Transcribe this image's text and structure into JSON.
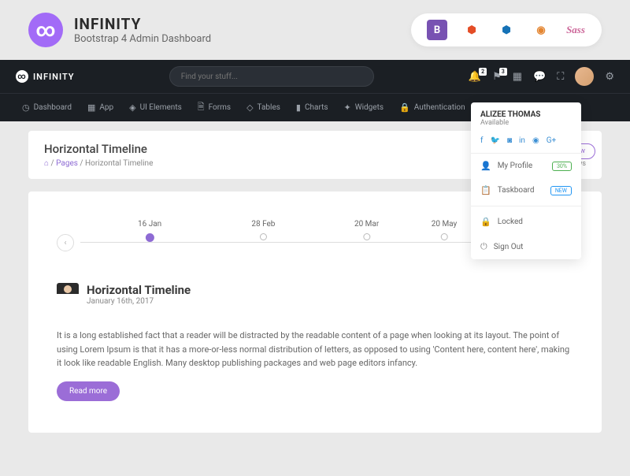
{
  "banner": {
    "title": "INFINITY",
    "subtitle": "Bootstrap 4 Admin Dashboard"
  },
  "nav": {
    "brand": "INFINITY",
    "search_placeholder": "Find your stuff...",
    "notif_count": "2",
    "msg_count": "3"
  },
  "menu": [
    "Dashboard",
    "App",
    "UI Elements",
    "Forms",
    "Tables",
    "Charts",
    "Widgets",
    "Authentication"
  ],
  "page": {
    "title": "Horizontal Timeline",
    "crumb_pages": "Pages",
    "crumb_current": "Horizontal Timeline",
    "views_label": "Page Views"
  },
  "timeline": {
    "points": [
      {
        "label": "16 Jan",
        "pos": 18,
        "active": true
      },
      {
        "label": "28 Feb",
        "pos": 40,
        "active": false
      },
      {
        "label": "20 Mar",
        "pos": 60,
        "active": false
      },
      {
        "label": "20 May",
        "pos": 75,
        "active": false
      }
    ]
  },
  "event": {
    "title": "Horizontal Timeline",
    "date": "January 16th, 2017",
    "body": "It is a long established fact that a reader will be distracted by the readable content of a page when looking at its layout. The point of using Lorem Ipsum is that it has a more-or-less normal distribution of letters, as opposed to using 'Content here, content here', making it look like readable English. Many desktop publishing packages and web page editors infancy.",
    "read_more": "Read more"
  },
  "dropdown": {
    "name": "ALIZEE THOMAS",
    "status": "Available",
    "items": {
      "profile": "My Profile",
      "taskboard": "Taskboard",
      "locked": "Locked",
      "signout": "Sign Out",
      "badge_profile": "30%",
      "badge_task": "NEW"
    }
  },
  "add_new": "+ Add New"
}
